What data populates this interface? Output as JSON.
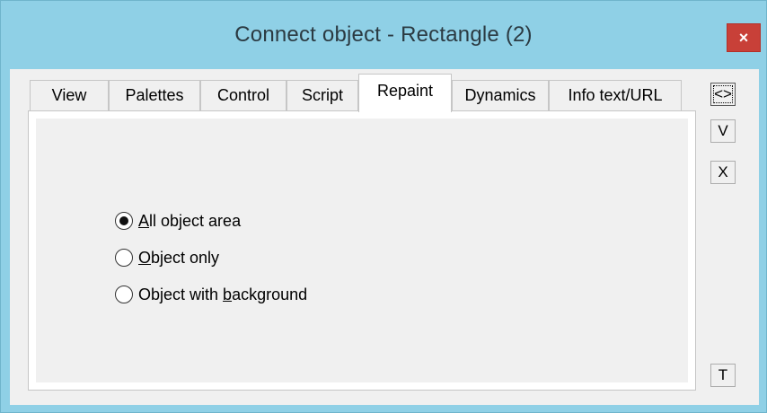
{
  "window": {
    "title": "Connect object - Rectangle (2)",
    "close_glyph": "×",
    "accent_color": "#8fd0e6",
    "close_color": "#c84038"
  },
  "tabs": [
    {
      "label": "View",
      "active": false
    },
    {
      "label": "Palettes",
      "active": false
    },
    {
      "label": "Control",
      "active": false
    },
    {
      "label": "Script",
      "active": false
    },
    {
      "label": "Repaint",
      "active": true
    },
    {
      "label": "Dynamics",
      "active": false
    },
    {
      "label": "Info text/URL",
      "active": false
    }
  ],
  "repaint": {
    "options": [
      {
        "prefix": "",
        "mnemonic": "A",
        "rest": "ll object area",
        "selected": true
      },
      {
        "prefix": "",
        "mnemonic": "O",
        "rest": "bject only",
        "selected": false
      },
      {
        "prefix": "Object with ",
        "mnemonic": "b",
        "rest": "ackground",
        "selected": false
      }
    ]
  },
  "side_buttons": {
    "expand": "<>",
    "ok": "V",
    "cancel": "X",
    "tooltip": "T"
  }
}
